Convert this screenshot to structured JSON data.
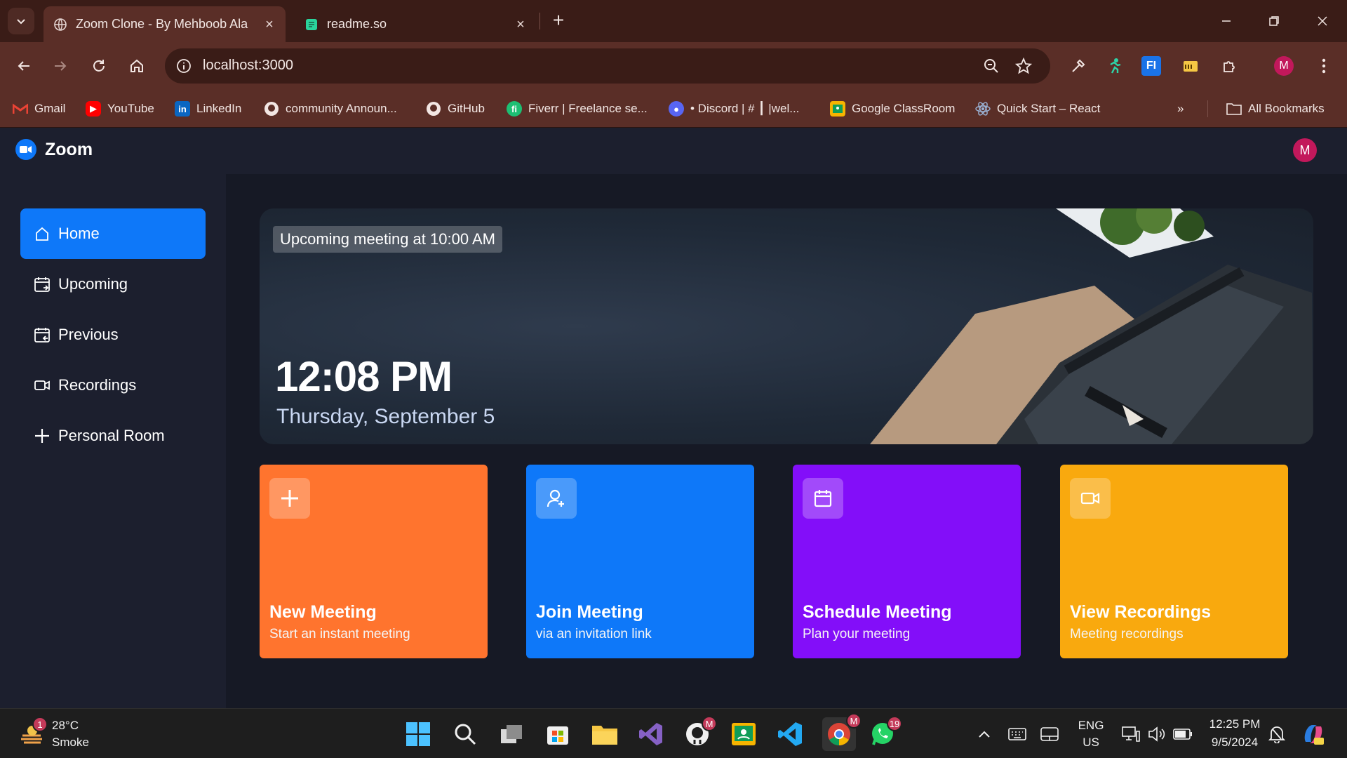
{
  "browser": {
    "tabs": [
      {
        "title": "Zoom Clone - By Mehboob Ala",
        "active": true
      },
      {
        "title": "readme.so",
        "active": false
      }
    ],
    "url": "localhost:3000",
    "profile_initial": "M"
  },
  "bookmarks": {
    "items": [
      {
        "label": "Gmail",
        "icon": "gmail-icon"
      },
      {
        "label": "YouTube",
        "icon": "youtube-icon"
      },
      {
        "label": "LinkedIn",
        "icon": "linkedin-icon"
      },
      {
        "label": "community Announ...",
        "icon": "github-icon"
      },
      {
        "label": "GitHub",
        "icon": "github-icon"
      },
      {
        "label": "Fiverr | Freelance se...",
        "icon": "fiverr-icon"
      },
      {
        "label": "• Discord | # ┃ |wel...",
        "icon": "discord-icon"
      },
      {
        "label": "Google ClassRoom",
        "icon": "classroom-icon"
      },
      {
        "label": "Quick Start – React",
        "icon": "react-icon"
      }
    ],
    "all_bookmarks": "All Bookmarks"
  },
  "app": {
    "brand": "Zoom",
    "avatar_initial": "M",
    "sidebar": [
      {
        "label": "Home",
        "icon": "home-icon",
        "active": true
      },
      {
        "label": "Upcoming",
        "icon": "calendar-upcoming-icon",
        "active": false
      },
      {
        "label": "Previous",
        "icon": "calendar-previous-icon",
        "active": false
      },
      {
        "label": "Recordings",
        "icon": "video-icon",
        "active": false
      },
      {
        "label": "Personal Room",
        "icon": "plus-icon",
        "active": false
      }
    ],
    "hero": {
      "badge": "Upcoming meeting at 10:00 AM",
      "time": "12:08 PM",
      "date": "Thursday, September 5"
    },
    "cards": [
      {
        "title": "New Meeting",
        "subtitle": "Start an instant meeting",
        "color": "#ff742e",
        "icon": "plus-icon"
      },
      {
        "title": "Join Meeting",
        "subtitle": "via an invitation link",
        "color": "#0e78f9",
        "icon": "add-user-icon"
      },
      {
        "title": "Schedule Meeting",
        "subtitle": "Plan your meeting",
        "color": "#830ef9",
        "icon": "calendar-icon"
      },
      {
        "title": "View Recordings",
        "subtitle": "Meeting recordings",
        "color": "#f9a90e",
        "icon": "video-icon"
      }
    ]
  },
  "taskbar": {
    "weather_temp": "28°C",
    "weather_desc": "Smoke",
    "weather_badge": "1",
    "github_badge": "M",
    "chrome_badge": "M",
    "whatsapp_badge": "19",
    "lang_line1": "ENG",
    "lang_line2": "US",
    "time": "12:25 PM",
    "date": "9/5/2024"
  }
}
